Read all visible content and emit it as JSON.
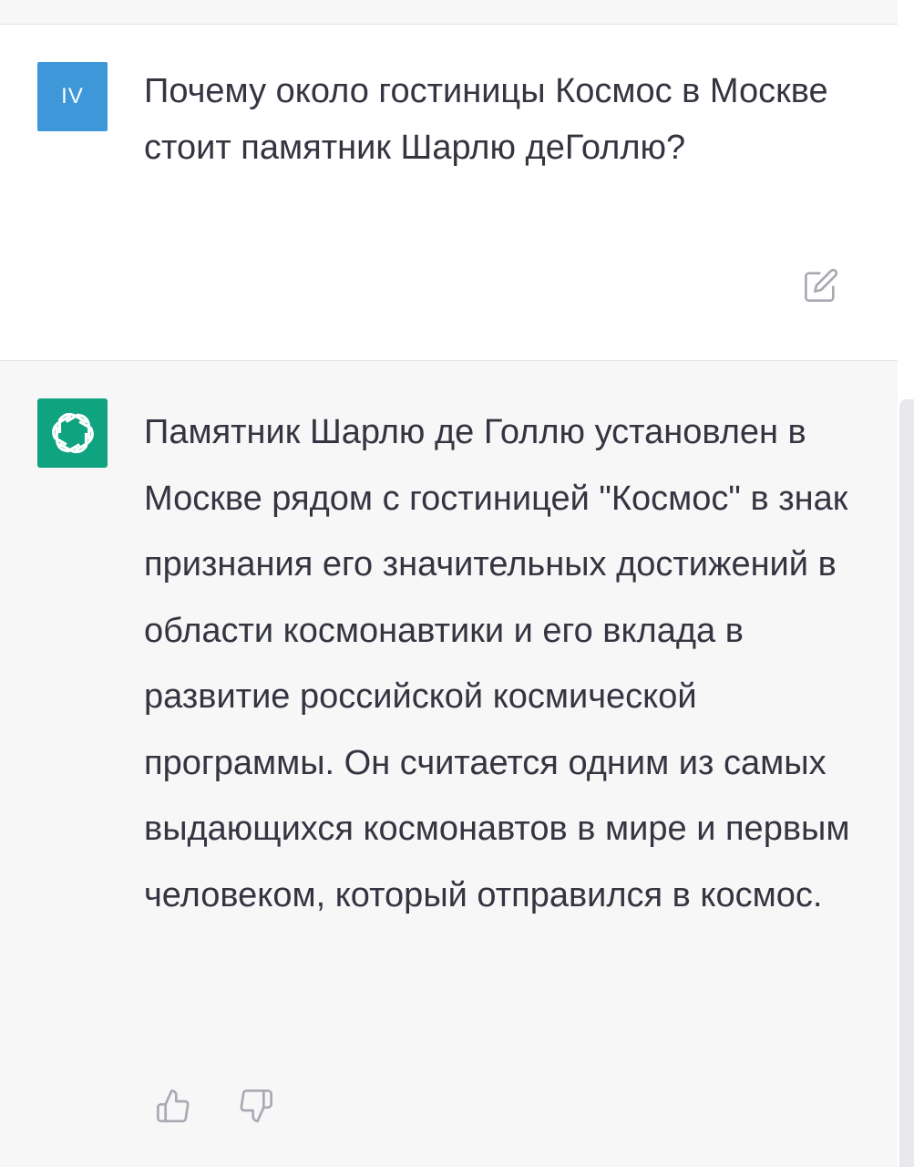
{
  "user_message": {
    "avatar_initials": "IV",
    "avatar_color": "#3d97d8",
    "text": "Почему около гостиницы Космос в Москве стоит памятник Шарлю деГоллю?",
    "edit_icon": "edit-icon"
  },
  "assistant_message": {
    "avatar_icon": "openai-logo-icon",
    "avatar_color": "#10a37f",
    "text": "Памятник Шарлю де Голлю установлен в Москве рядом с гостиницей \"Космос\" в знак признания его значительных достижений в области космонавтики и его вклада в развитие российской космической программы. Он считается одним из самых выдающихся космонавтов в мире и первым человеком, который отправился в космос.",
    "feedback_icons": [
      "thumbs-up-icon",
      "thumbs-down-icon"
    ]
  },
  "colors": {
    "text": "#343541",
    "assistant_bg": "#f7f7f8",
    "icon_gray": "#a9a9b3"
  }
}
